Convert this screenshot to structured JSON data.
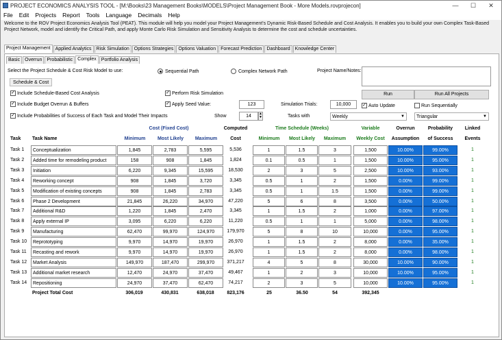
{
  "window": {
    "title": "PROJECT ECONOMICS ANALYSIS TOOL - [M:\\Books\\23 Management Books\\MODELS\\Project Management Book - More Models.rovprojecon]",
    "controls": [
      "—",
      "☐",
      "✕"
    ]
  },
  "menu": [
    "File",
    "Edit",
    "Projects",
    "Report",
    "Tools",
    "Language",
    "Decimals",
    "Help"
  ],
  "welcome": "Welcome to the ROV Project Economics Analysis Tool (PEAT). This module will help you model your Project Management's Dynamic Risk-Based Schedule and Cost Analysis. It enables you to build your own Complex Task-Based Project Network, model and identify the Critical Path, and apply Monte Carlo Risk Simulation and Sensitivity Analysis to determine the cost and schedule uncertainties.",
  "main_tabs": [
    "Project Management",
    "Applied Analytics",
    "Risk Simulation",
    "Options Strategies",
    "Options Valuation",
    "Forecast Prediction",
    "Dashboard",
    "Knowledge Center"
  ],
  "sub_tabs": [
    "Basic",
    "Overrun",
    "Probabilistic",
    "Complex",
    "Portfolio Analysis"
  ],
  "controls": {
    "select_label": "Select the Project Schedule & Cost Risk Model to use:",
    "sequential": "Sequential Path",
    "complex": "Complex Network Path",
    "project_name_label": "Project Name/Notes:",
    "schedule_cost_btn": "Schedule & Cost",
    "include_schedule": "Include Schedule-Based Cost Analysis",
    "include_budget": "Include Budget Overrun & Buffers",
    "include_prob": "Include Probabilities of Success of Each Task and Model Their Impacts",
    "perform_risk": "Perform Risk Simulation",
    "apply_seed": "Apply Seed Value:",
    "seed_value": "123",
    "sim_trials_label": "Simulation Trials:",
    "sim_trials": "10,000",
    "show_label": "Show",
    "show_value": "14",
    "tasks_with_label": "Tasks with",
    "tasks_with": "Weekly",
    "run": "Run",
    "run_all": "Run All Projects",
    "auto_update": "Auto Update",
    "run_seq": "Run Sequentially",
    "distribution": "Triangular"
  },
  "headers": {
    "cost_group": "Cost (Fixed Cost)",
    "time_group": "Time Schedule (Weeks)",
    "computed1": "Computed",
    "computed2": "Cost",
    "variable1": "Variable",
    "variable2": "Weekly Cost",
    "overrun1": "Overrun",
    "overrun2": "Assumption",
    "prob1": "Probability",
    "prob2": "of Success",
    "linked1": "Linked",
    "linked2": "Events",
    "task": "Task",
    "task_name": "Task Name",
    "minimum": "Minimum",
    "most_likely": "Most Likely",
    "maximum": "Maximum"
  },
  "rows": [
    {
      "task": "Task 1",
      "name": "Conceptualization",
      "cmin": "1,845",
      "cml": "2,783",
      "cmax": "5,595",
      "cc": "5,536",
      "tmin": "1",
      "tml": "1.5",
      "tmax": "3",
      "wc": "1,500",
      "ov": "10.00%",
      "ps": "99.00%",
      "le": "1"
    },
    {
      "task": "Task 2",
      "name": "Added time for remodeling product",
      "cmin": "158",
      "cml": "908",
      "cmax": "1,845",
      "cc": "1,824",
      "tmin": "0.1",
      "tml": "0.5",
      "tmax": "1",
      "wc": "1,500",
      "ov": "10.00%",
      "ps": "95.00%",
      "le": "1"
    },
    {
      "task": "Task 3",
      "name": "Initiation",
      "cmin": "6,220",
      "cml": "9,345",
      "cmax": "15,595",
      "cc": "18,530",
      "tmin": "2",
      "tml": "3",
      "tmax": "5",
      "wc": "2,500",
      "ov": "10.00%",
      "ps": "93.00%",
      "le": "1"
    },
    {
      "task": "Task 4",
      "name": "Reworking concept",
      "cmin": "908",
      "cml": "1,845",
      "cmax": "3,720",
      "cc": "3,345",
      "tmin": "0.5",
      "tml": "1",
      "tmax": "2",
      "wc": "1,500",
      "ov": "0.00%",
      "ps": "99.00%",
      "le": "1"
    },
    {
      "task": "Task 5",
      "name": "Modification of existing concepts",
      "cmin": "908",
      "cml": "1,845",
      "cmax": "2,783",
      "cc": "3,345",
      "tmin": "0.5",
      "tml": "1",
      "tmax": "1.5",
      "wc": "1,500",
      "ov": "0.00%",
      "ps": "99.00%",
      "le": "1"
    },
    {
      "task": "Task 6",
      "name": "Phase 2 Development",
      "cmin": "21,845",
      "cml": "26,220",
      "cmax": "34,970",
      "cc": "47,220",
      "tmin": "5",
      "tml": "6",
      "tmax": "8",
      "wc": "3,500",
      "ov": "0.00%",
      "ps": "50.00%",
      "le": "1"
    },
    {
      "task": "Task 7",
      "name": "Additional R&D",
      "cmin": "1,220",
      "cml": "1,845",
      "cmax": "2,470",
      "cc": "3,345",
      "tmin": "1",
      "tml": "1.5",
      "tmax": "2",
      "wc": "1,000",
      "ov": "0.00%",
      "ps": "97.00%",
      "le": "1"
    },
    {
      "task": "Task 8",
      "name": "Apply external IP",
      "cmin": "3,095",
      "cml": "6,220",
      "cmax": "6,220",
      "cc": "11,220",
      "tmin": "0.5",
      "tml": "1",
      "tmax": "1",
      "wc": "5,000",
      "ov": "0.00%",
      "ps": "98.00%",
      "le": "1"
    },
    {
      "task": "Task 9",
      "name": "Manufacturing",
      "cmin": "62,470",
      "cml": "99,970",
      "cmax": "124,970",
      "cc": "179,970",
      "tmin": "5",
      "tml": "8",
      "tmax": "10",
      "wc": "10,000",
      "ov": "0.00%",
      "ps": "95.00%",
      "le": "1"
    },
    {
      "task": "Task 10",
      "name": "Reprototyping",
      "cmin": "9,970",
      "cml": "14,970",
      "cmax": "19,970",
      "cc": "26,970",
      "tmin": "1",
      "tml": "1.5",
      "tmax": "2",
      "wc": "8,000",
      "ov": "0.00%",
      "ps": "35.00%",
      "le": "1"
    },
    {
      "task": "Task 11",
      "name": "Recasting and rework",
      "cmin": "9,970",
      "cml": "14,970",
      "cmax": "19,970",
      "cc": "26,970",
      "tmin": "1",
      "tml": "1.5",
      "tmax": "2",
      "wc": "8,000",
      "ov": "0.00%",
      "ps": "98.00%",
      "le": "1"
    },
    {
      "task": "Task 12",
      "name": "Market Analysis",
      "cmin": "149,970",
      "cml": "187,470",
      "cmax": "299,970",
      "cc": "371,217",
      "tmin": "4",
      "tml": "5",
      "tmax": "8",
      "wc": "30,000",
      "ov": "10.00%",
      "ps": "90.00%",
      "le": "1"
    },
    {
      "task": "Task 13",
      "name": "Additional market research",
      "cmin": "12,470",
      "cml": "24,970",
      "cmax": "37,470",
      "cc": "49,467",
      "tmin": "1",
      "tml": "2",
      "tmax": "3",
      "wc": "10,000",
      "ov": "10.00%",
      "ps": "95.00%",
      "le": "1"
    },
    {
      "task": "Task 14",
      "name": "Repositioning",
      "cmin": "24,970",
      "cml": "37,470",
      "cmax": "62,470",
      "cc": "74,217",
      "tmin": "2",
      "tml": "3",
      "tmax": "5",
      "wc": "10,000",
      "ov": "10.00%",
      "ps": "95.00%",
      "le": "1"
    }
  ],
  "totals": {
    "label": "Project Total Cost",
    "cmin": "306,019",
    "cml": "430,831",
    "cmax": "638,018",
    "cc": "823,176",
    "tmin": "25",
    "tml": "36.50",
    "tmax": "54",
    "wc": "392,345"
  },
  "colors": {
    "accent_blue": "#1570d6",
    "header_blue": "#1f3f8f",
    "header_green": "#1a7a1a"
  }
}
